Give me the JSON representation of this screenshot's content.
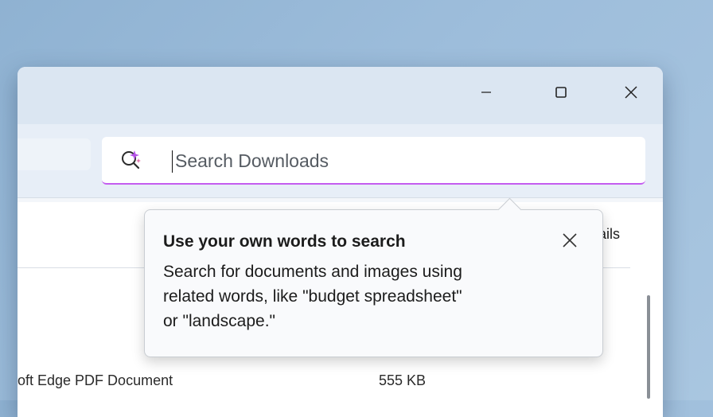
{
  "window": {
    "controls": {
      "minimize_icon": "minimize-icon",
      "maximize_icon": "maximize-icon",
      "close_icon": "close-icon"
    }
  },
  "search": {
    "placeholder": "Search Downloads",
    "icon": "ai-search-icon",
    "accent_color": "#c45cf0"
  },
  "toolbar": {
    "details_label": "ails"
  },
  "tooltip": {
    "title": "Use your own words to search",
    "body_line_1": "Search for documents and images using",
    "body_line_2": "related words, like \"budget spreadsheet\"",
    "body_line_3": "or \"landscape.\"",
    "close_icon": "close-icon"
  },
  "file_row": {
    "type": "oft Edge PDF Document",
    "size": "555 KB"
  }
}
